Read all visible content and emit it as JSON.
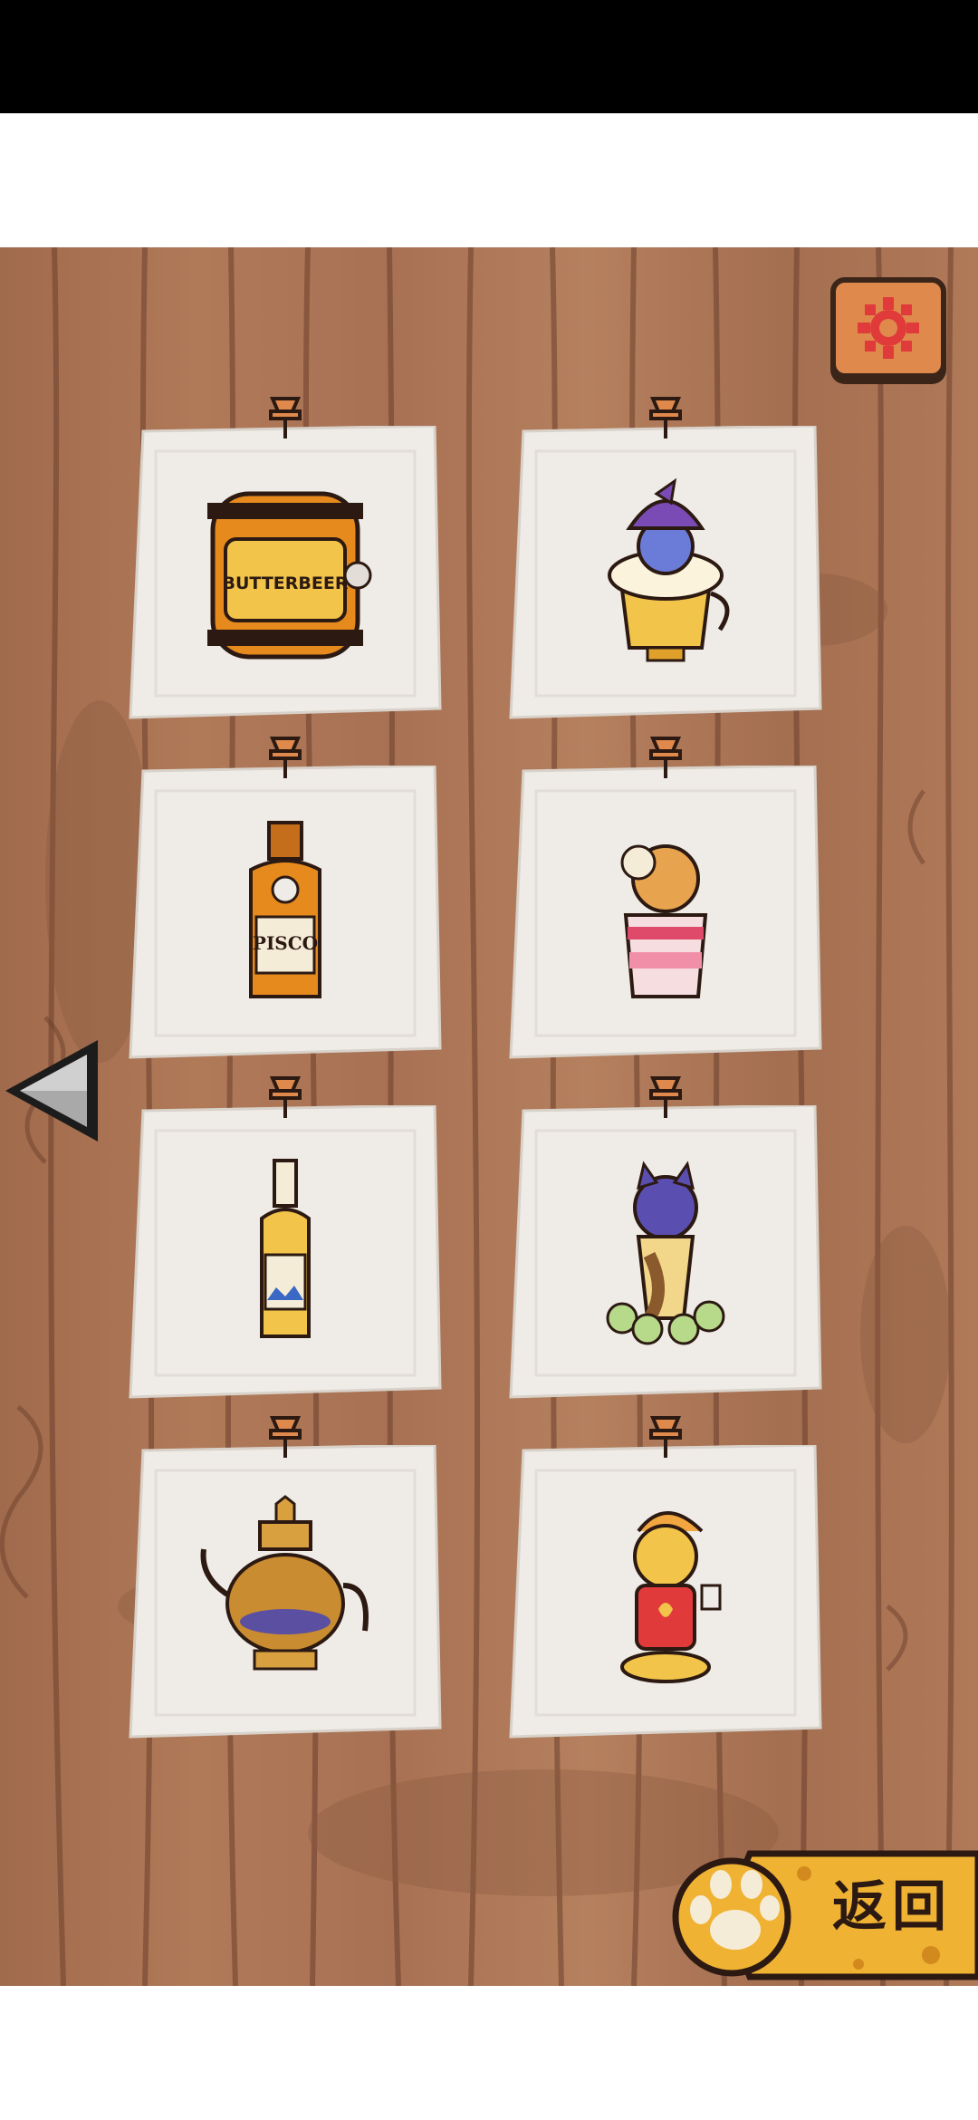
{
  "screen": {
    "name": "drink-collection"
  },
  "colors": {
    "wood": "#a87154",
    "paper": "#efebe6",
    "accent": "#e0894d",
    "outline": "#2c1a12"
  },
  "notes": [
    {
      "name": "butterbeer-barrel",
      "label": "BUTTERBEER",
      "icon": "barrel-icon"
    },
    {
      "name": "wizard-cat-beer-mug",
      "label": "",
      "icon": "beer-mug-icon"
    },
    {
      "name": "pisco-bottle",
      "label": "PISCO",
      "icon": "bottle-icon"
    },
    {
      "name": "llama-cat-glass",
      "label": "",
      "icon": "glass-icon"
    },
    {
      "name": "liquor-bottle",
      "label": "",
      "icon": "bottle-icon"
    },
    {
      "name": "cat-grape-glass",
      "label": "",
      "icon": "glass-icon"
    },
    {
      "name": "teapot",
      "label": "",
      "icon": "teapot-icon"
    },
    {
      "name": "cat-figure",
      "label": "",
      "icon": "cat-icon"
    }
  ],
  "controls": {
    "settings": {
      "icon": "gear-icon"
    },
    "prev": {
      "icon": "left-arrow-icon"
    },
    "return": {
      "label": "返回",
      "icon": "paw-icon"
    }
  }
}
